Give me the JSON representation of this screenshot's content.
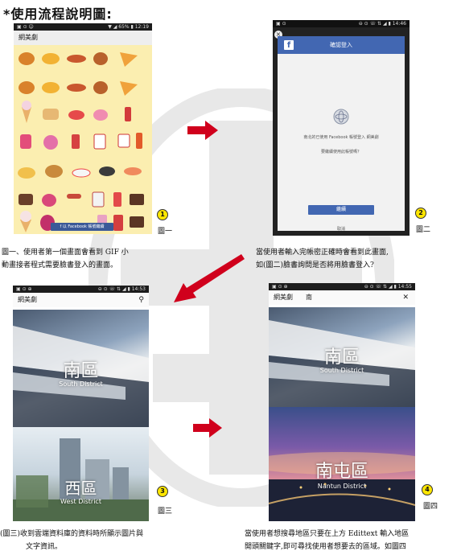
{
  "heading": "*使用流程說明圖:",
  "screen1": {
    "status_left": "▣ ⊙ ☺",
    "status_right": "▼ ◢ 65% ▮ 12:19",
    "app_title": "網美劇",
    "fb_button_label": "f 以 Facebook 帳號繼續",
    "badge": "1",
    "fig_label": "圖一"
  },
  "screen2": {
    "status_left": "▣ ⊙",
    "status_right": "⊖ ⊙ ☏ ⇅ ◢ ▮ 14:46",
    "dialog_title": "確認登入",
    "fb_logo": "f",
    "close_icon_text": "×",
    "message": "南北的已使用 Facebook 帳號登入 網美劇",
    "question": "要繼續使用此帳號嗎？",
    "continue_label": "繼續",
    "cancel_label": "取消",
    "badge": "2",
    "fig_label": "圖二"
  },
  "screen3": {
    "status_left": "▣ ⊙ ⊕",
    "status_right": "⊖ ⊙ ☏ ⇅ ◢ ▮ 14:53",
    "app_title": "網美劇",
    "search_icon_text": "⚲",
    "panels": [
      {
        "name": "南區",
        "sub": "South District"
      },
      {
        "name": "西區",
        "sub": "West District"
      }
    ],
    "badge": "3",
    "fig_label": "圖三"
  },
  "screen4": {
    "status_left": "▣ ⊙ ⊕",
    "status_right": "⊖ ⊙ ☏ ⇅ ◢ ▮ 14:55",
    "app_title": "網美劇",
    "search_text": "南",
    "close_text": "✕",
    "panels": [
      {
        "name": "南區",
        "sub": "South District"
      },
      {
        "name": "南屯區",
        "sub": "Nantun District"
      }
    ],
    "badge": "4",
    "fig_label": "圖四"
  },
  "captions": {
    "c1_line1": "圖一、使用者第一個畫面會看到 GIF 小",
    "c1_line2": "動畫接者程式需要臉書登入的畫面。",
    "c2_line1": "當使用者輸入完帳密正確時會看到此畫面,",
    "c2_line2": "如(圖二)臉書詢問是否將用臉書登入?",
    "c3_line1": "(圖三)收到雲端資料庫的資料時所顯示圖片與",
    "c3_line2": "文字資訊。",
    "c4_line1": "當使用者想搜尋地區只要在上方 Edittext 輸入地區",
    "c4_line2": "開頭關鍵字,即可尋找使用者想要去的區域。如圖四"
  },
  "colors": {
    "arrow": "#d0001c",
    "facebook": "#4267b2",
    "badge": "#ffe600"
  }
}
